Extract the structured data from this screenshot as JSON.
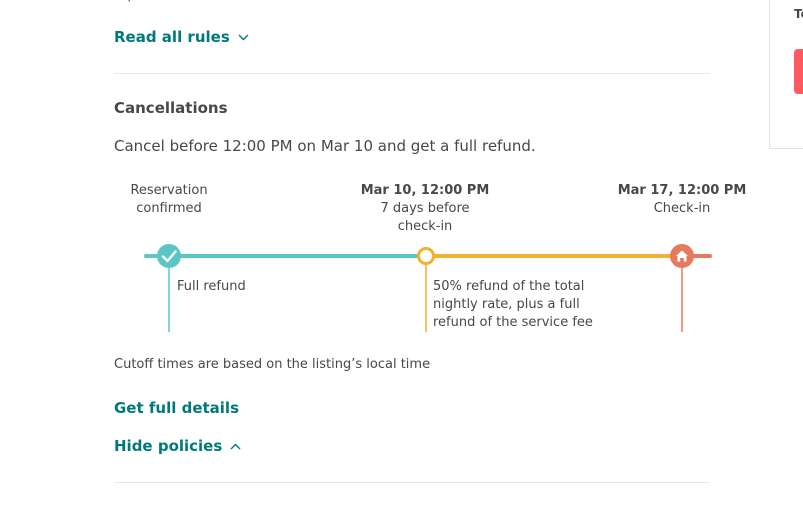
{
  "rules": {
    "cut_text": "..., ... .........",
    "read_all_label": "Read all rules"
  },
  "cancellations": {
    "title": "Cancellations",
    "summary": "Cancel before 12:00 PM on Mar 10 and get a full refund.",
    "timeline": [
      {
        "title": "",
        "lines": [
          "Reservation",
          "confirmed"
        ],
        "refund": "Full refund",
        "color": "#5cc6c5",
        "marker": "check-icon"
      },
      {
        "title": "Mar 10, 12:00 PM",
        "lines": [
          "7 days before",
          "check-in"
        ],
        "refund": "50% refund of the total nightly rate, plus a full refund of the service fee",
        "color": "#f2b12f",
        "marker": "circle-marker"
      },
      {
        "title": "Mar 17, 12:00 PM",
        "lines": [
          "Check-in"
        ],
        "refund": "",
        "color": "#e57a5f",
        "marker": "home-icon"
      }
    ],
    "note": "Cutoff times are based on the listing’s local time",
    "get_details_label": "Get full details",
    "hide_policies_label": "Hide policies"
  },
  "side_panel": {
    "text": "To"
  },
  "colors": {
    "link": "#00797b",
    "teal": "#5cc6c5",
    "amber": "#f2b12f",
    "coral": "#e57a5f",
    "brand": "#ff5a5f"
  }
}
